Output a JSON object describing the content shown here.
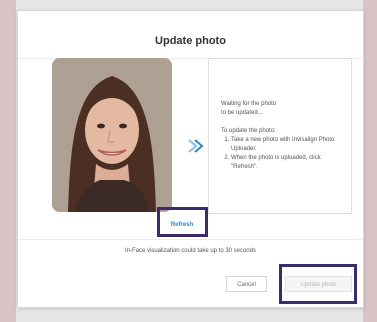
{
  "dialog": {
    "title": "Update photo",
    "info": {
      "waiting_line1": "Waiting for the photo",
      "waiting_line2": "to be updated...",
      "instructions_heading": "To update the photo:",
      "steps": [
        "Take a new photo with Invisalign Photo Uploader.",
        "When the photo is uploaded, click \"Refresh\"."
      ]
    },
    "refresh_label": "Refresh",
    "note": "In-Face visualization could take up to 30 seconds",
    "buttons": {
      "cancel_label": "Cancel",
      "update_label": "Update photo"
    },
    "icons": {
      "photo": "patient-photo",
      "arrow": "chevron-right-icon"
    },
    "colors": {
      "accent": "#2f86c4",
      "highlight": "#3a2a6e"
    }
  }
}
